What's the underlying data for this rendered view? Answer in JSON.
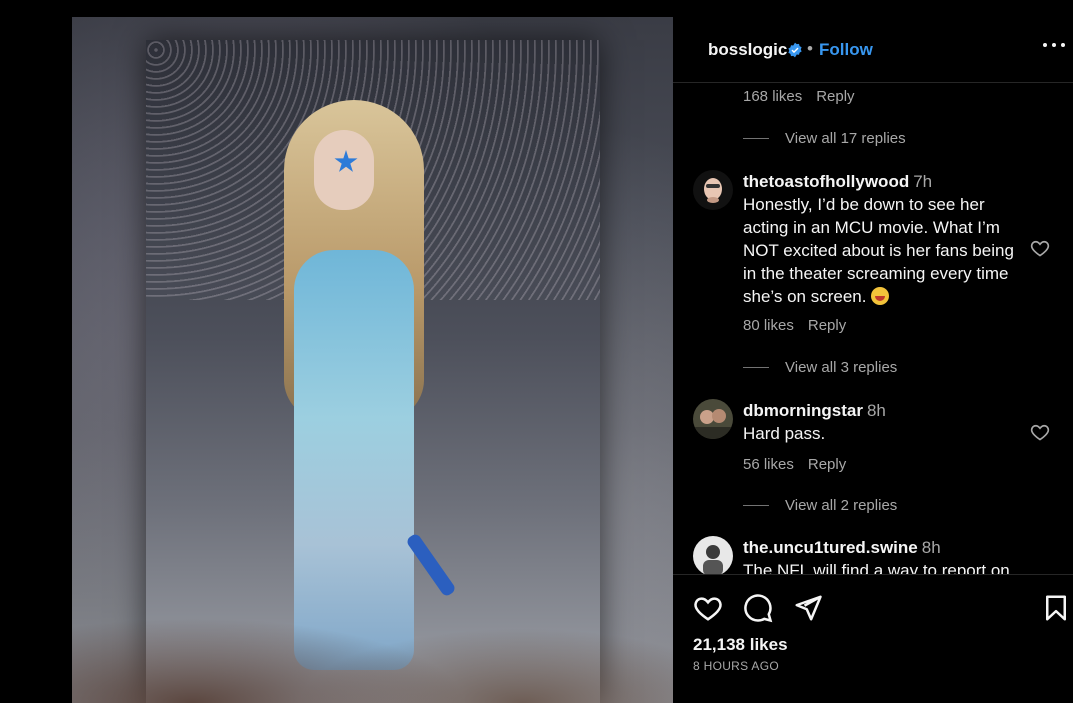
{
  "post": {
    "image_alt": "post-photo"
  },
  "header": {
    "username": "bosslogic",
    "separator": "•",
    "follow_label": "Follow"
  },
  "comments": {
    "top_meta": {
      "likes": "168 likes",
      "reply": "Reply"
    },
    "top_view_replies": "View all 17 replies",
    "items": [
      {
        "username": "thetoastofhollywood",
        "time": "7h",
        "text": "Honestly, I’d be down to see her acting in an MCU movie. What I’m NOT excited about is her fans being in the theater screaming every time she’s on screen.",
        "likes": "80 likes",
        "reply": "Reply",
        "view_replies": "View all 3 replies"
      },
      {
        "username": "dbmorningstar",
        "time": "8h",
        "text": "Hard pass.",
        "likes": "56 likes",
        "reply": "Reply",
        "view_replies": "View all 2 replies"
      },
      {
        "username": "the.uncu1tured.swine",
        "time": "8h",
        "text": "The NFL will find a way to report on"
      }
    ]
  },
  "footer": {
    "likes": "21,138 likes",
    "time_ago": "8 HOURS AGO"
  },
  "colors": {
    "accent": "#3897f0",
    "secondary_text": "#a8a8a8",
    "primary_text": "#f5f5f5",
    "background": "#000000"
  }
}
